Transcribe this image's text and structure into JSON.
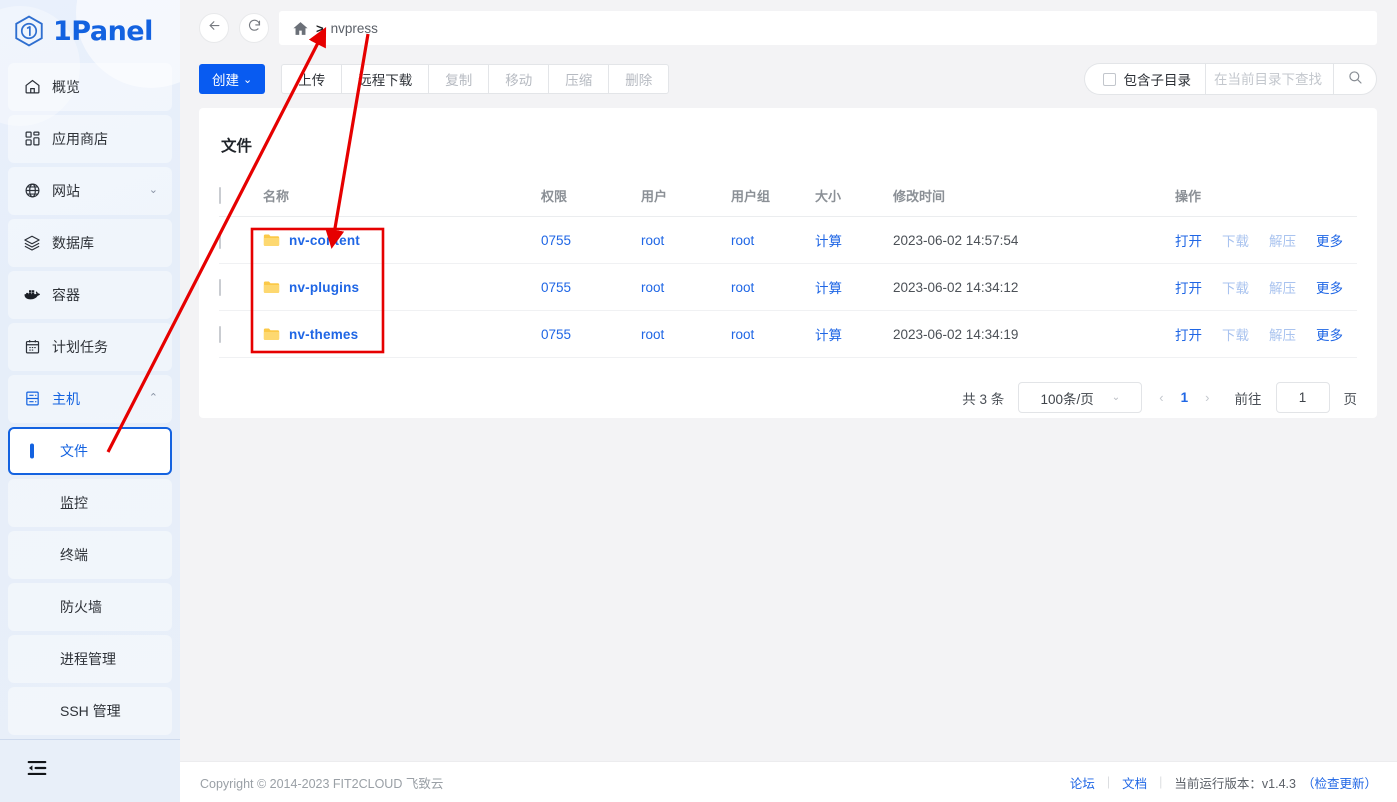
{
  "brand": {
    "name": "1Panel"
  },
  "sidebar": {
    "items": [
      {
        "label": "概览",
        "icon": "home-icon",
        "type": "item"
      },
      {
        "label": "应用商店",
        "icon": "apps-icon",
        "type": "item"
      },
      {
        "label": "网站",
        "icon": "globe-icon",
        "type": "item",
        "chevron": "⌄"
      },
      {
        "label": "数据库",
        "icon": "database-icon",
        "type": "item"
      },
      {
        "label": "容器",
        "icon": "docker-icon",
        "type": "item"
      },
      {
        "label": "计划任务",
        "icon": "calendar-icon",
        "type": "item"
      },
      {
        "label": "主机",
        "icon": "host-icon",
        "type": "item",
        "chevron": "⌃",
        "active": true
      }
    ],
    "sub_items": [
      {
        "label": "文件",
        "selected": true
      },
      {
        "label": "监控",
        "selected": false
      },
      {
        "label": "终端",
        "selected": false
      },
      {
        "label": "防火墙",
        "selected": false
      },
      {
        "label": "进程管理",
        "selected": false
      },
      {
        "label": "SSH 管理",
        "selected": false
      }
    ],
    "collapse_icon": "menu-fold-icon"
  },
  "topbar": {
    "back_icon": "arrow-left-icon",
    "refresh_icon": "refresh-icon",
    "breadcrumb": {
      "home_icon": "home-icon",
      "separator": ">",
      "path": "nvpress"
    }
  },
  "toolbar": {
    "create_label": "创建",
    "create_caret": "⌄",
    "buttons": [
      {
        "label": "上传",
        "disabled": false
      },
      {
        "label": "远程下载",
        "disabled": false
      },
      {
        "label": "复制",
        "disabled": true
      },
      {
        "label": "移动",
        "disabled": true
      },
      {
        "label": "压缩",
        "disabled": true
      },
      {
        "label": "删除",
        "disabled": true
      }
    ],
    "include_subdir_label": "包含子目录",
    "search_placeholder": "在当前目录下查找",
    "search_value": "",
    "search_icon": "search-icon"
  },
  "card": {
    "title": "文件",
    "columns": [
      "名称",
      "权限",
      "用户",
      "用户组",
      "大小",
      "修改时间",
      "操作"
    ],
    "rows": [
      {
        "name": "nv-content",
        "perm": "0755",
        "user": "root",
        "group": "root",
        "size": "计算",
        "mtime": "2023-06-02 14:57:54",
        "ops": [
          {
            "label": "打开",
            "disabled": false
          },
          {
            "label": "下载",
            "disabled": true
          },
          {
            "label": "解压",
            "disabled": true
          },
          {
            "label": "更多",
            "disabled": false
          }
        ]
      },
      {
        "name": "nv-plugins",
        "perm": "0755",
        "user": "root",
        "group": "root",
        "size": "计算",
        "mtime": "2023-06-02 14:34:12",
        "ops": [
          {
            "label": "打开",
            "disabled": false
          },
          {
            "label": "下载",
            "disabled": true
          },
          {
            "label": "解压",
            "disabled": true
          },
          {
            "label": "更多",
            "disabled": false
          }
        ]
      },
      {
        "name": "nv-themes",
        "perm": "0755",
        "user": "root",
        "group": "root",
        "size": "计算",
        "mtime": "2023-06-02 14:34:19",
        "ops": [
          {
            "label": "打开",
            "disabled": false
          },
          {
            "label": "下载",
            "disabled": true
          },
          {
            "label": "解压",
            "disabled": true
          },
          {
            "label": "更多",
            "disabled": false
          }
        ]
      }
    ]
  },
  "pagination": {
    "total_label": "共 3 条",
    "page_size_label": "100条/页",
    "prev_icon": "‹",
    "next_icon": "›",
    "current_page": "1",
    "goto_label": "前往",
    "goto_value": "1",
    "page_unit": "页"
  },
  "footer": {
    "copyright": "Copyright © 2014-2023 FIT2CLOUD 飞致云",
    "forum_label": "论坛",
    "docs_label": "文档",
    "version_label": "当前运行版本：v1.4.3",
    "check_update_label": "（检查更新）"
  },
  "annotations": {
    "color": "#e60000",
    "highlight_box": "folder-name-group"
  }
}
